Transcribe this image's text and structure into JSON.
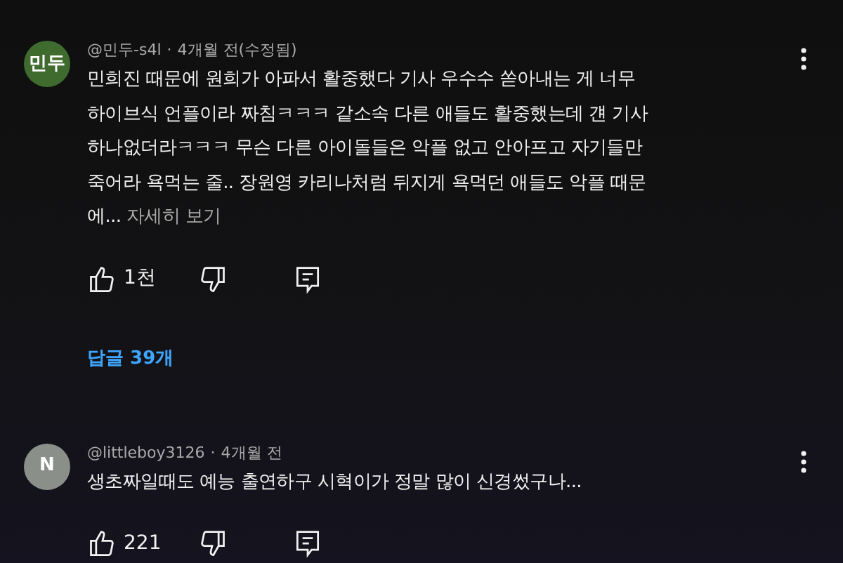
{
  "comments": [
    {
      "avatar": {
        "text": "민두",
        "color": "#3f6b2f"
      },
      "author": "@민두-s4l",
      "separator": "·",
      "time": "4개월 전(수정됨)",
      "body": "민희진 때문에 원희가 아파서 활중했다 기사 우수수 쏟아내는 게 너무 하이브식 언플이라 짜침ㅋㅋㅋ 같소속 다른 애들도 활중했는데 걘 기사 하나없더라ㅋㅋㅋ 무슨 다른 아이돌들은 악플 없고 안아프고 자기들만 죽어라 욕먹는 줄.. 장원영 카리나처럼 뒤지게 욕먹던 애들도 악플 때문에...",
      "more": "자세히 보기",
      "likes": "1천",
      "replies": "답글 39개"
    },
    {
      "avatar": {
        "text": "N",
        "color": "#8a8f8a"
      },
      "author": "@littleboy3126",
      "separator": "·",
      "time": "4개월 전",
      "body": "생초짜일때도 예능 출연하구 시혁이가 정말 많이 신경썼구나...",
      "likes": "221"
    }
  ]
}
